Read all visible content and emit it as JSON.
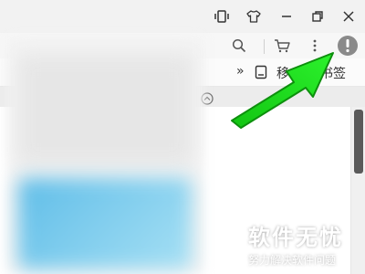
{
  "bookmarks": {
    "overflow_label": "»",
    "visible_text": "移",
    "bookmark_text": "备书签"
  },
  "brand": {
    "name": "软件无忧",
    "slogan": "努力解决软件问题"
  },
  "colors": {
    "arrow": "#1de01d",
    "info_button": "#8a8a8a"
  }
}
